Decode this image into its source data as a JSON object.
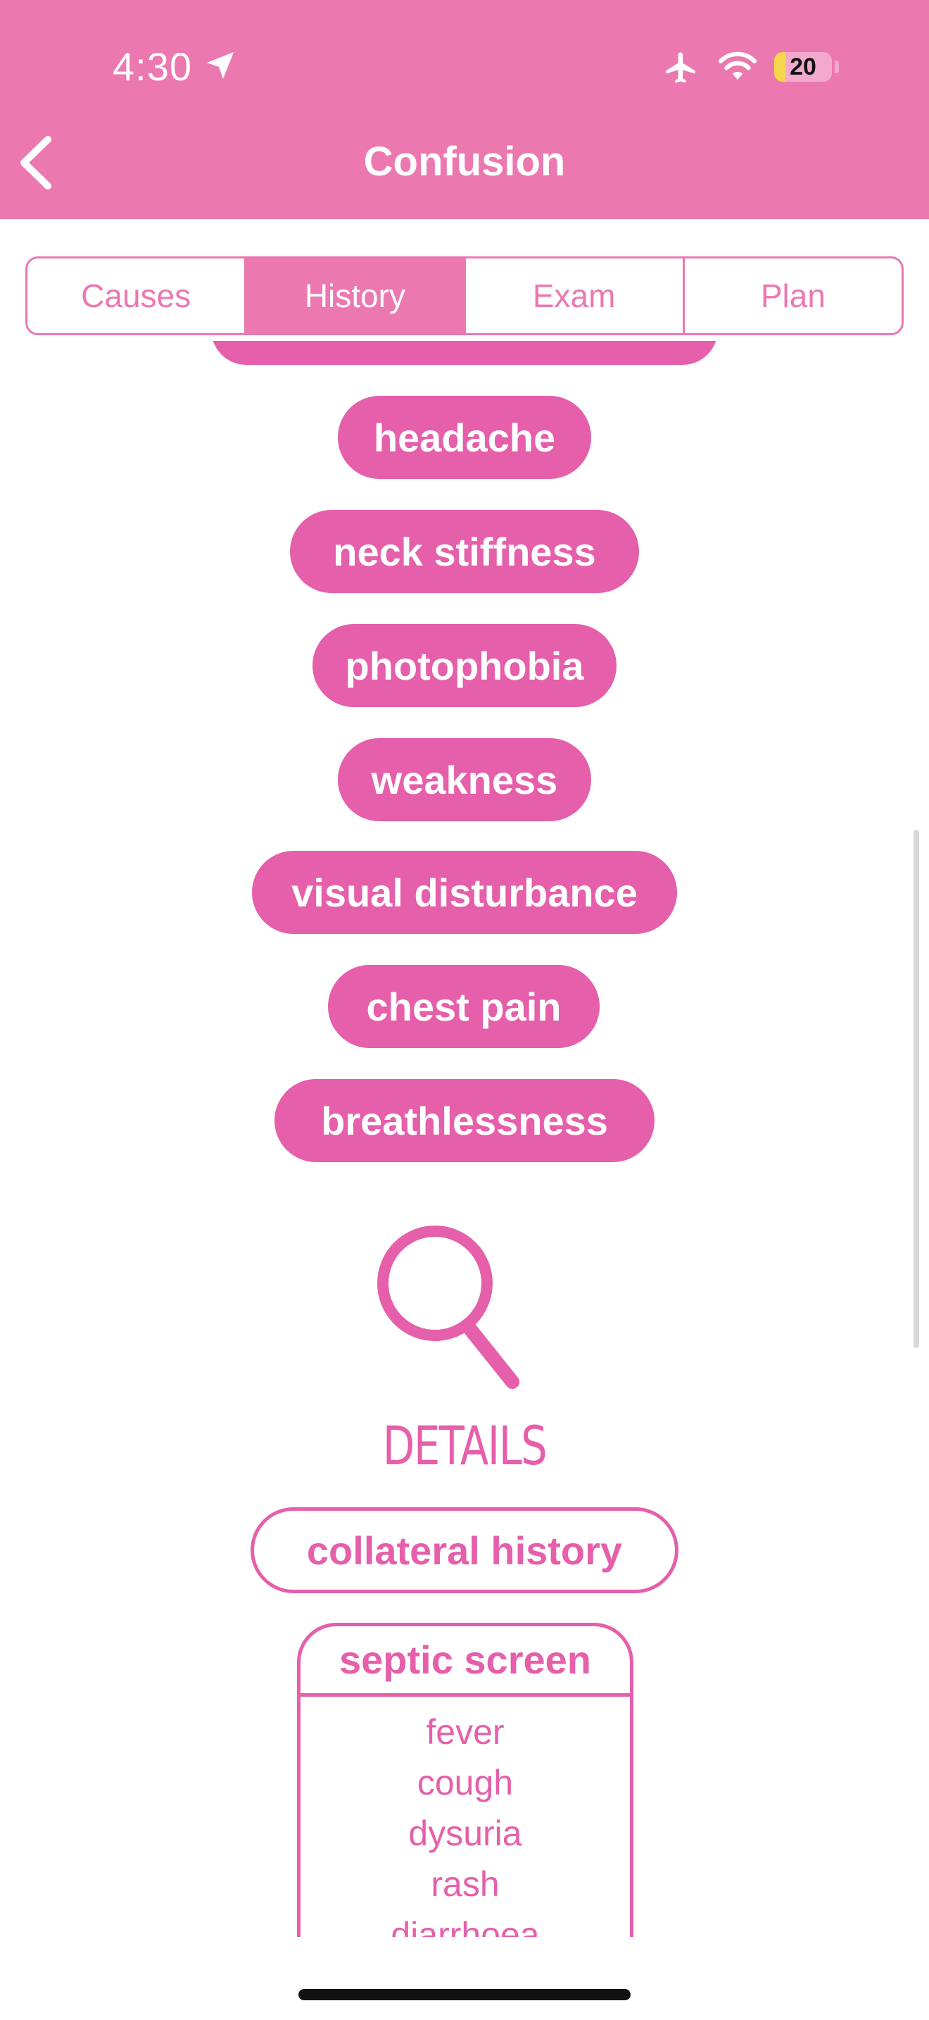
{
  "status_bar": {
    "time": "4:30",
    "battery_level": "20",
    "battery_fraction": 0.2,
    "icons": [
      "location-arrow-icon",
      "airplane-icon",
      "wifi-icon",
      "battery-icon"
    ]
  },
  "nav": {
    "title": "Confusion",
    "back_icon": "chevron-left-icon"
  },
  "tabs": [
    {
      "label": "Causes",
      "active": false
    },
    {
      "label": "History",
      "active": true
    },
    {
      "label": "Exam",
      "active": false
    },
    {
      "label": "Plan",
      "active": false
    }
  ],
  "symptoms": [
    "headache",
    "neck stiffness",
    "photophobia",
    "weakness",
    "visual disturbance",
    "chest pain",
    "breathlessness"
  ],
  "details": {
    "icon": "magnifier-icon",
    "heading": "DETAILS",
    "collateral_label": "collateral history",
    "septic_screen": {
      "title": "septic screen",
      "items": [
        "fever",
        "cough",
        "dysuria",
        "rash",
        "diarrhoea"
      ]
    }
  },
  "colors": {
    "header": "#EC78B0",
    "accent": "#E55FAA",
    "white": "#FFFFFF"
  }
}
